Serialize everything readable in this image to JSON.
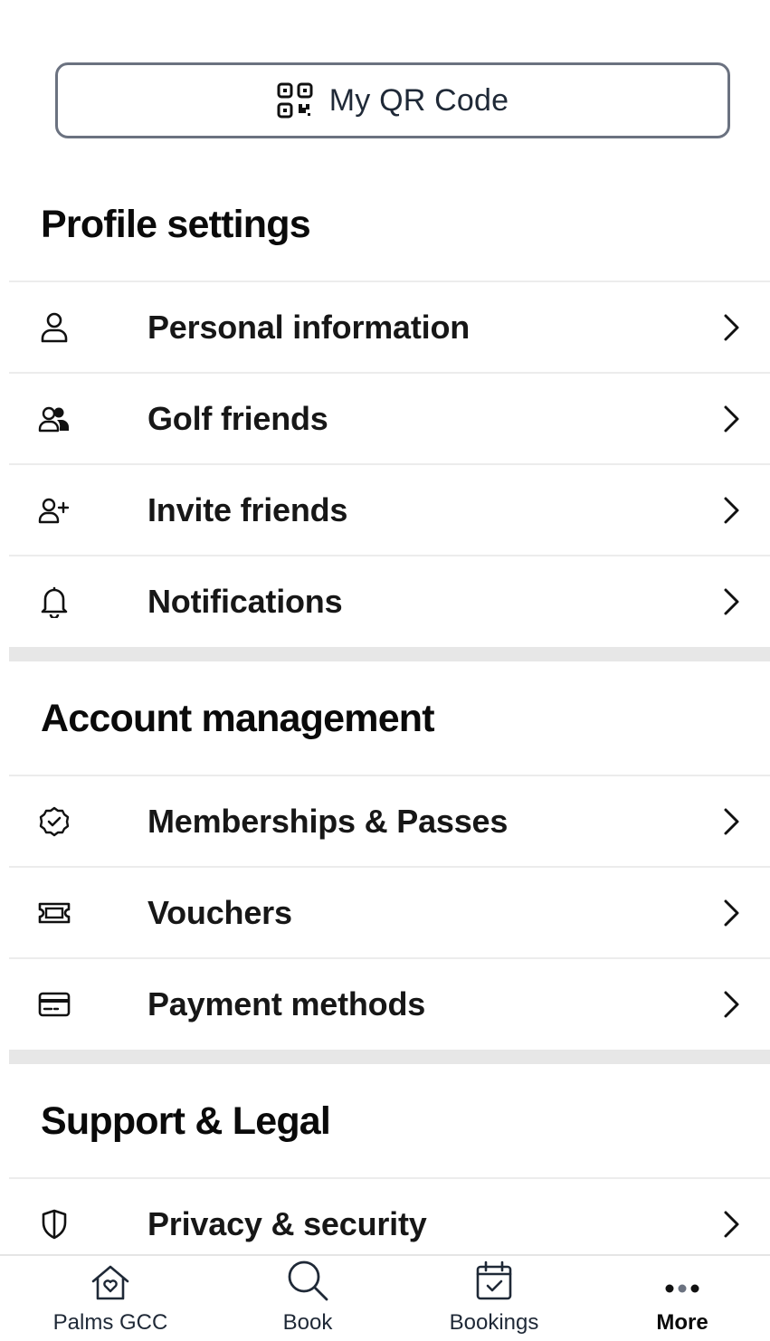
{
  "qr_button": {
    "label": "My QR Code",
    "icon": "qr-code-icon"
  },
  "sections": {
    "profile": {
      "title": "Profile settings",
      "items": [
        {
          "label": "Personal information",
          "icon": "person-icon"
        },
        {
          "label": "Golf friends",
          "icon": "friends-icon"
        },
        {
          "label": "Invite friends",
          "icon": "person-add-icon"
        },
        {
          "label": "Notifications",
          "icon": "bell-icon"
        }
      ]
    },
    "account": {
      "title": "Account management",
      "items": [
        {
          "label": "Memberships & Passes",
          "icon": "badge-check-icon"
        },
        {
          "label": "Vouchers",
          "icon": "ticket-icon"
        },
        {
          "label": "Payment methods",
          "icon": "credit-card-icon"
        }
      ]
    },
    "support": {
      "title": "Support & Legal",
      "items": [
        {
          "label": "Privacy & security",
          "icon": "shield-icon"
        }
      ]
    }
  },
  "tabbar": {
    "tabs": [
      {
        "label": "Palms GCC",
        "icon": "home-heart-icon"
      },
      {
        "label": "Book",
        "icon": "search-icon"
      },
      {
        "label": "Bookings",
        "icon": "calendar-check-icon"
      },
      {
        "label": "More",
        "icon": "more-dots-icon",
        "active": true
      }
    ]
  },
  "colors": {
    "text": "#111111",
    "divider": "#ececec",
    "section_gap": "#e7e7e7",
    "button_border": "#6b7280"
  }
}
